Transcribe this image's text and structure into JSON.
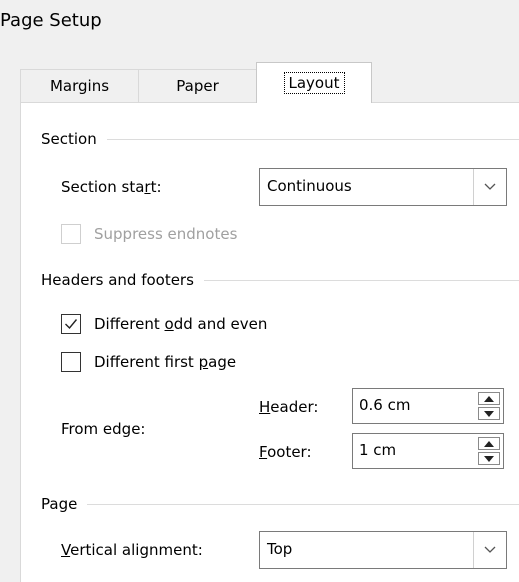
{
  "dialog": {
    "title": "Page Setup"
  },
  "tabs": [
    {
      "label": "Margins"
    },
    {
      "label": "Paper"
    },
    {
      "label": "Layout"
    }
  ],
  "section": {
    "group_label": "Section",
    "section_start_label_pre": "Section sta",
    "section_start_label_key": "r",
    "section_start_label_post": "t:",
    "section_start_value": "Continuous",
    "suppress_endnotes_label": "Suppress endnotes",
    "suppress_endnotes_checked": false
  },
  "headers_footers": {
    "group_label": "Headers and footers",
    "odd_even_pre": "Different ",
    "odd_even_key": "o",
    "odd_even_post": "dd and even",
    "odd_even_checked": true,
    "first_page_pre": "Different first ",
    "first_page_key": "p",
    "first_page_post": "age",
    "first_page_checked": false,
    "from_edge_label": "From edge:",
    "header_key": "H",
    "header_post": "eader:",
    "header_value": "0.6 cm",
    "footer_key": "F",
    "footer_post": "ooter:",
    "footer_value": "1 cm"
  },
  "page": {
    "group_label": "Page",
    "vertical_alignment_key": "V",
    "vertical_alignment_post": "ertical alignment:",
    "vertical_alignment_value": "Top"
  },
  "icons": {
    "dropdown": "chevron-down-icon",
    "spin_up": "triangle-up-icon",
    "spin_down": "triangle-down-icon",
    "check": "checkmark-icon"
  }
}
